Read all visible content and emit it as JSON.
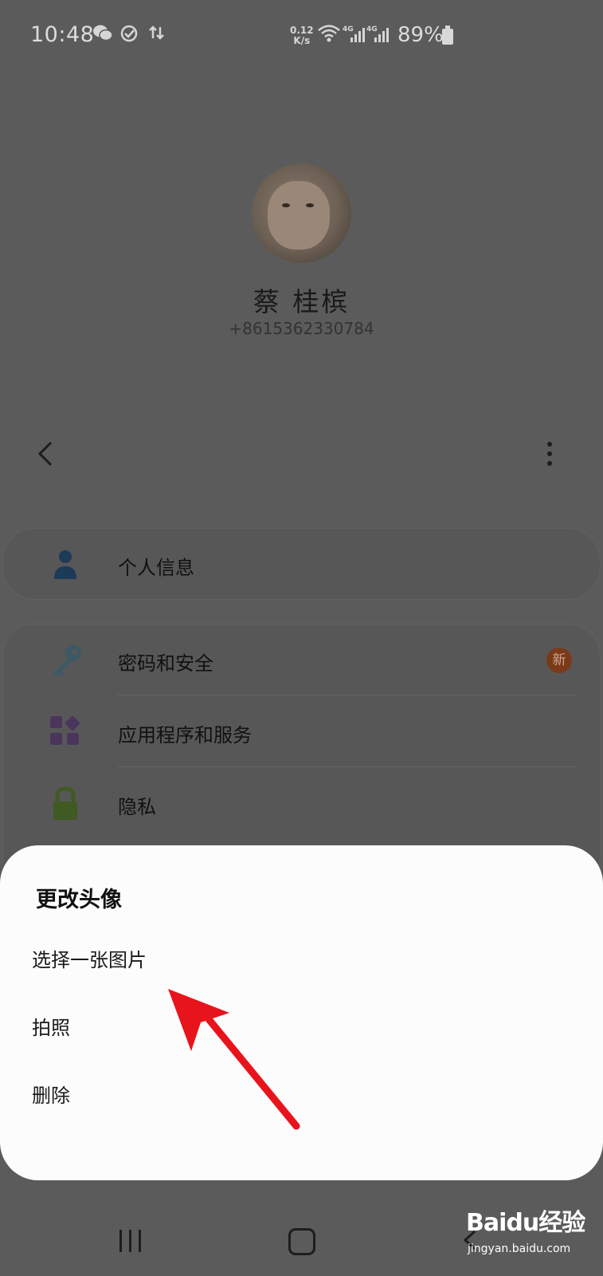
{
  "status_bar": {
    "time": "10:48",
    "net_speed_value": "0.12",
    "net_speed_unit": "K/s",
    "battery": "89%"
  },
  "profile": {
    "name": "蔡 桂槟",
    "phone": "+8615362330784"
  },
  "menu": {
    "personal_info": "个人信息",
    "password_security": "密码和安全",
    "new_badge": "新",
    "apps_services": "应用程序和服务",
    "privacy": "隐私"
  },
  "sheet": {
    "title": "更改头像",
    "options": [
      "选择一张图片",
      "拍照",
      "删除"
    ]
  },
  "watermark": {
    "main": "Baidu经验",
    "sub": "jingyan.baidu.com"
  },
  "colors": {
    "overlay_background": "#5b5b5b",
    "sheet_background": "#fcfcfc",
    "arrow": "#e8141c",
    "badge": "#7a3a1a"
  }
}
